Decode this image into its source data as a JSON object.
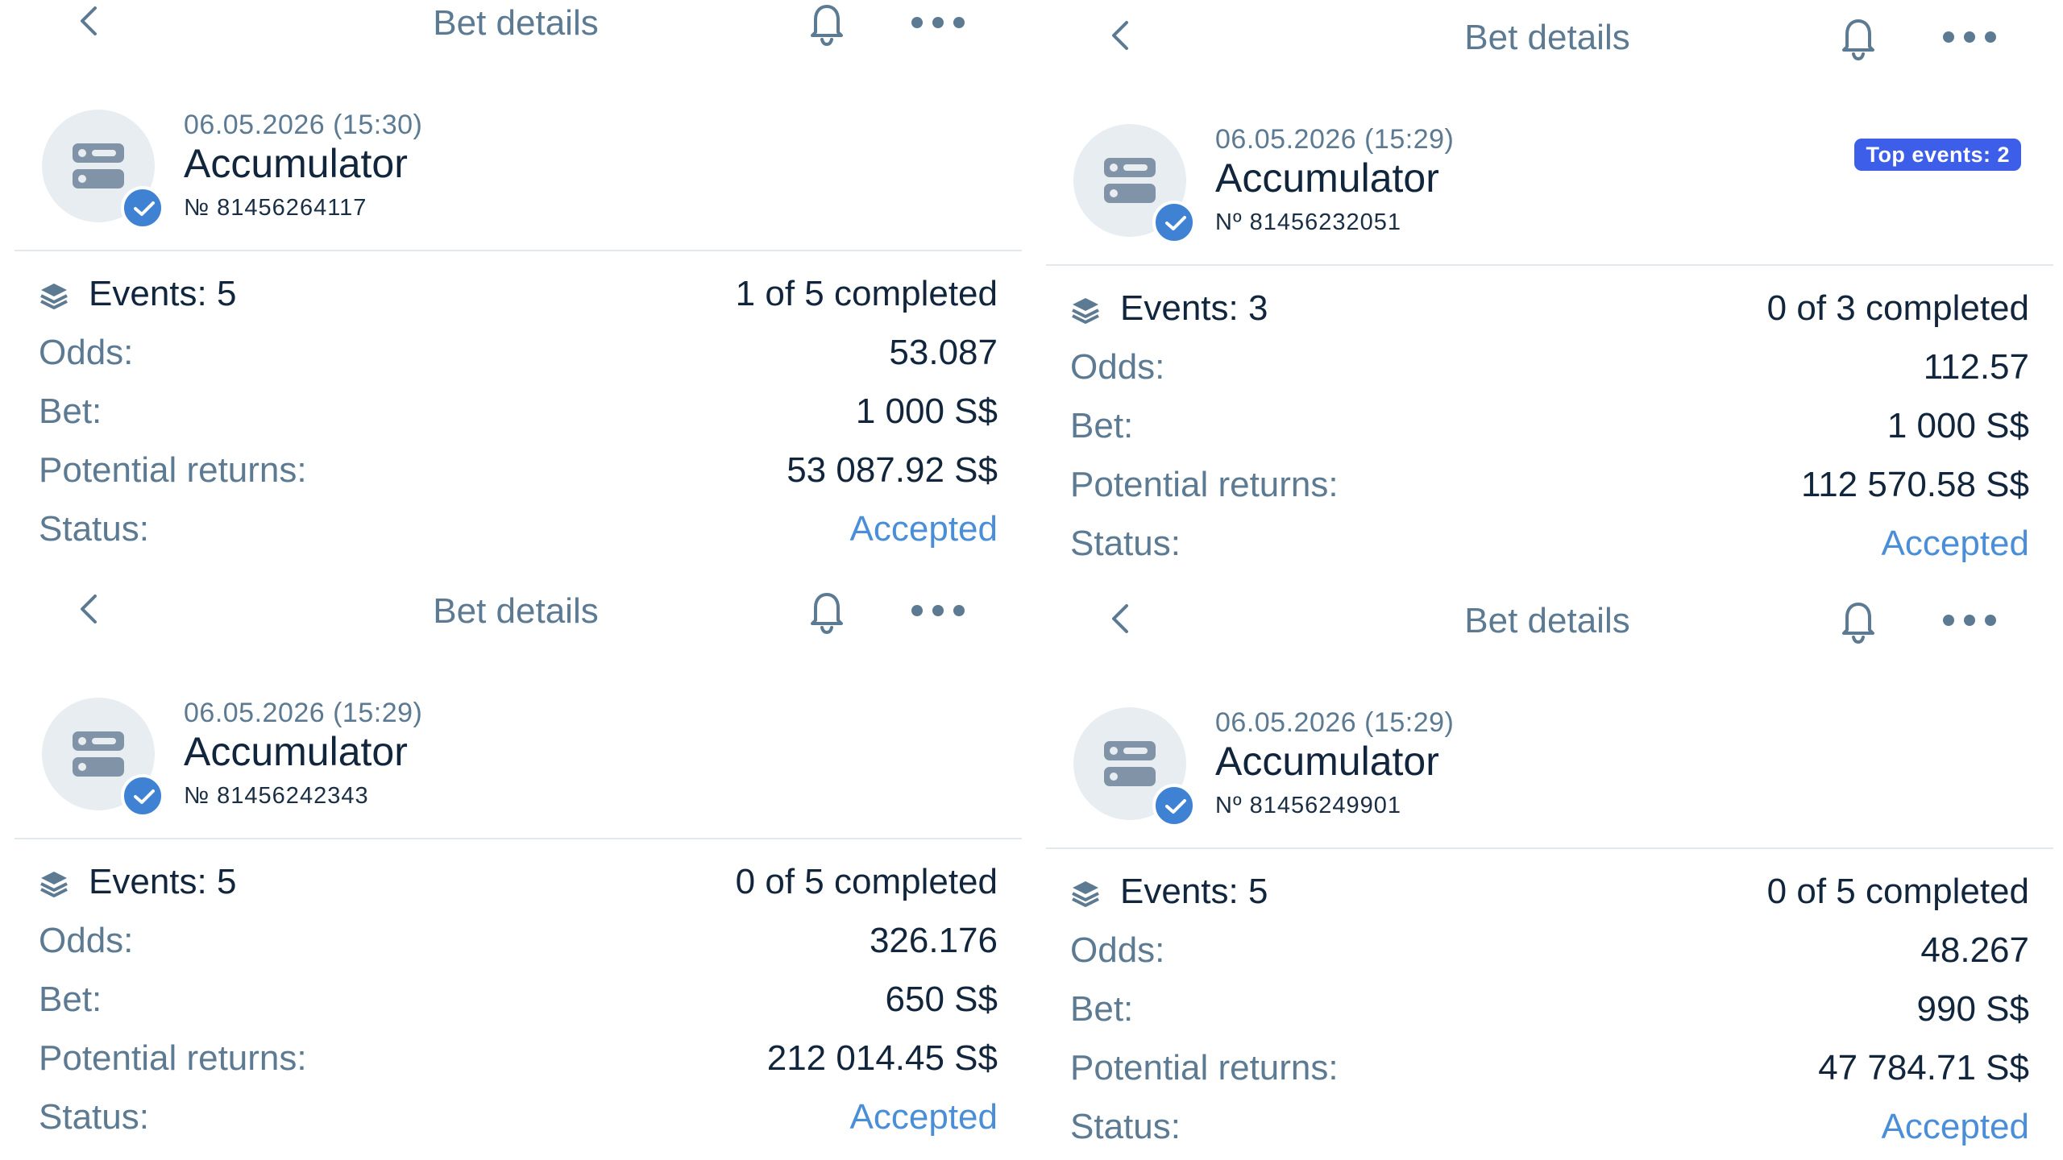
{
  "colors": {
    "accent": "#4a8ed8",
    "check_badge": "#3f82d4",
    "top_events_badge": "#3d5ee8",
    "primary_text": "#11263d",
    "secondary_text": "#5d7a93",
    "avatar_bg": "#e8edf2"
  },
  "icons": [
    "chevron-left-icon",
    "bell-icon",
    "more-icon",
    "coupon-icon",
    "check-icon",
    "layers-icon"
  ],
  "panels": [
    {
      "header_title": "Bet details",
      "date": "06.05.2026 (15:30)",
      "bet_type": "Accumulator",
      "bet_number": "№ 81456264117",
      "badge": "",
      "events_label": "Events: 5",
      "events_progress": "1 of 5 completed",
      "odds_label": "Odds:",
      "odds": "53.087",
      "bet_label": "Bet:",
      "bet": "1 000 S$",
      "returns_label": "Potential returns:",
      "returns": "53 087.92 S$",
      "status_label": "Status:",
      "status": "Accepted"
    },
    {
      "header_title": "Bet details",
      "date": "06.05.2026 (15:29)",
      "bet_type": "Accumulator",
      "bet_number": "Nº 81456232051",
      "badge": "Top events: 2",
      "events_label": "Events: 3",
      "events_progress": "0 of 3 completed",
      "odds_label": "Odds:",
      "odds": "112.57",
      "bet_label": "Bet:",
      "bet": "1 000 S$",
      "returns_label": "Potential returns:",
      "returns": "112 570.58 S$",
      "status_label": "Status:",
      "status": "Accepted"
    },
    {
      "header_title": "Bet details",
      "date": "06.05.2026 (15:29)",
      "bet_type": "Accumulator",
      "bet_number": "№ 81456242343",
      "badge": "",
      "events_label": "Events: 5",
      "events_progress": "0 of 5 completed",
      "odds_label": "Odds:",
      "odds": "326.176",
      "bet_label": "Bet:",
      "bet": "650 S$",
      "returns_label": "Potential returns:",
      "returns": "212 014.45 S$",
      "status_label": "Status:",
      "status": "Accepted"
    },
    {
      "header_title": "Bet details",
      "date": "06.05.2026 (15:29)",
      "bet_type": "Accumulator",
      "bet_number": "Nº 81456249901",
      "badge": "",
      "events_label": "Events: 5",
      "events_progress": "0 of 5 completed",
      "odds_label": "Odds:",
      "odds": "48.267",
      "bet_label": "Bet:",
      "bet": "990 S$",
      "returns_label": "Potential returns:",
      "returns": "47 784.71 S$",
      "status_label": "Status:",
      "status": "Accepted"
    }
  ]
}
